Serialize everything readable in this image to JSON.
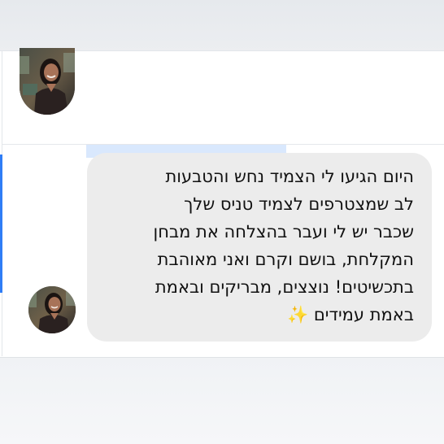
{
  "conversation": {
    "message": {
      "text": "היום הגיעו לי הצמיד נחש והטבעות\nלב שמצטרפים לצמיד טניס שלך\nשכבר יש לי ועבר בהצלחה את מבחן\nהמקלחת, בושם וקרם ואני מאוהבת\nבתכשיטים! נוצצים, מבריקים ובאמת\nבאמת עמידים ✨"
    },
    "colors": {
      "bubble_background": "#ececec",
      "accent": "#2f7df6",
      "selection": "#d9e8fd"
    }
  }
}
